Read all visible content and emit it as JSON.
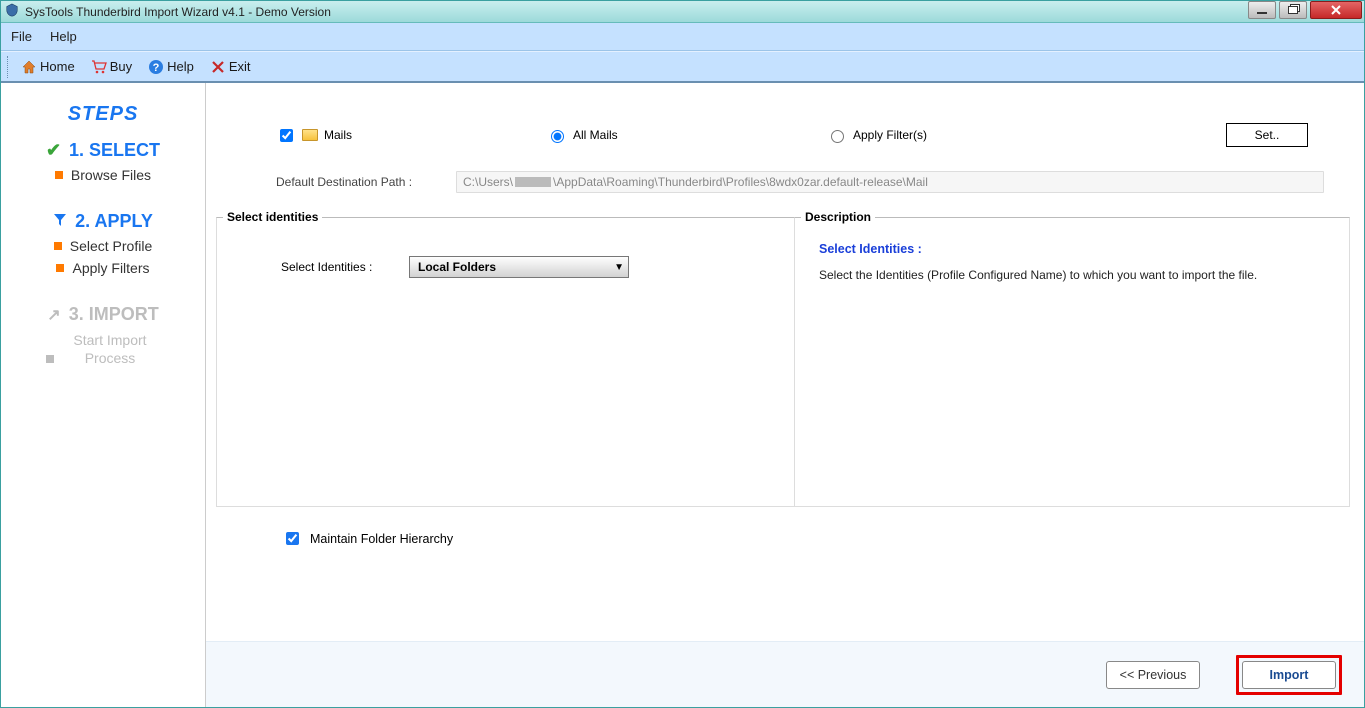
{
  "titlebar": {
    "title": "SysTools Thunderbird Import Wizard v4.1 - Demo Version"
  },
  "menubar": {
    "file": "File",
    "help": "Help"
  },
  "toolbar": {
    "home": "Home",
    "buy": "Buy",
    "help": "Help",
    "exit": "Exit"
  },
  "sidebar": {
    "heading": "STEPS",
    "step1": {
      "title": "1. SELECT",
      "sub1": "Browse Files"
    },
    "step2": {
      "title": "2. APPLY",
      "sub1": "Select Profile",
      "sub2": "Apply Filters"
    },
    "step3": {
      "title": "3. IMPORT",
      "sub1": "Start Import Process"
    }
  },
  "options": {
    "mails": "Mails",
    "all_mails": "All Mails",
    "apply_filters": "Apply Filter(s)",
    "set_btn": "Set.."
  },
  "path": {
    "label": "Default Destination Path :",
    "prefix": "C:\\Users\\",
    "suffix": "\\AppData\\Roaming\\Thunderbird\\Profiles\\8wdx0zar.default-release\\Mail"
  },
  "identities": {
    "legend": "Select identities",
    "label": "Select Identities :",
    "selected": "Local Folders"
  },
  "description": {
    "legend": "Description",
    "heading": "Select Identities :",
    "body": "Select the Identities (Profile Configured Name) to  which  you want to import the file."
  },
  "maintain_hierarchy": "Maintain Folder Hierarchy",
  "footer": {
    "previous": "<< Previous",
    "import": "Import"
  }
}
